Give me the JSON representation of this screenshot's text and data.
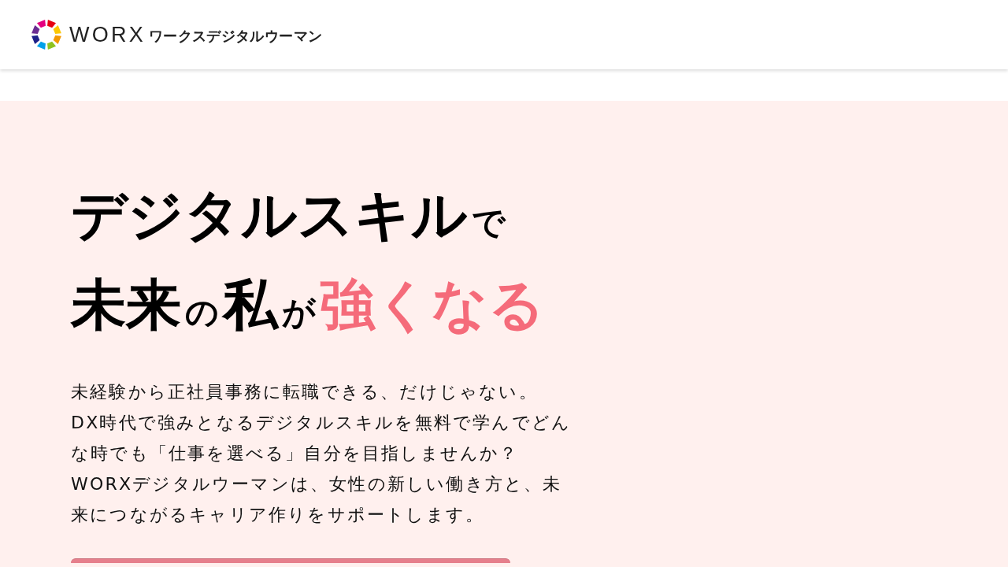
{
  "header": {
    "logo": {
      "wordmark": "WORX",
      "name": "ワークスデジタルウーマン"
    }
  },
  "hero": {
    "headline": [
      {
        "segments": [
          {
            "text": "デジタルスキル",
            "kind": "word",
            "highlight": false
          },
          {
            "text": "で",
            "kind": "particle",
            "highlight": false
          }
        ]
      },
      {
        "segments": [
          {
            "text": "未来",
            "kind": "word",
            "highlight": false
          },
          {
            "text": "の",
            "kind": "particle",
            "highlight": false
          },
          {
            "text": "私",
            "kind": "word",
            "highlight": false
          },
          {
            "text": "が",
            "kind": "particle",
            "highlight": false
          },
          {
            "text": "強くなる",
            "kind": "word",
            "highlight": true
          }
        ]
      }
    ],
    "lead": "未経験から正社員事務に転職できる、だけじゃない。\nDX時代で強みとなるデジタルスキルを無料で学んでどんな時でも「仕事を選べる」自分を目指しませんか？\nWORXデジタルウーマンは、女性の新しい働き方と、未来につながるキャリア作りをサポートします。"
  }
}
